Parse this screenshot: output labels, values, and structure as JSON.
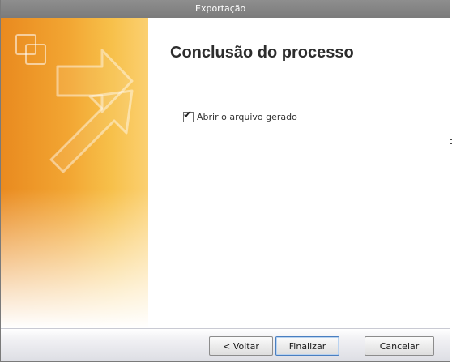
{
  "window": {
    "title": "Exportação"
  },
  "main": {
    "heading": "Conclusão do processo",
    "open_file_option": {
      "label": "Abrir o arquivo gerado",
      "checked": true
    }
  },
  "footer": {
    "back_button": "< Voltar",
    "finish_button": "Finalizar",
    "cancel_button": "Cancelar"
  },
  "colors": {
    "accent_orange": "#e98a1f",
    "accent_yellow": "#fbd071",
    "titlebar": "#7b7b7b",
    "default_button_border": "#4a7fc0"
  },
  "icons": {
    "banner": "export-arrow-icon"
  }
}
